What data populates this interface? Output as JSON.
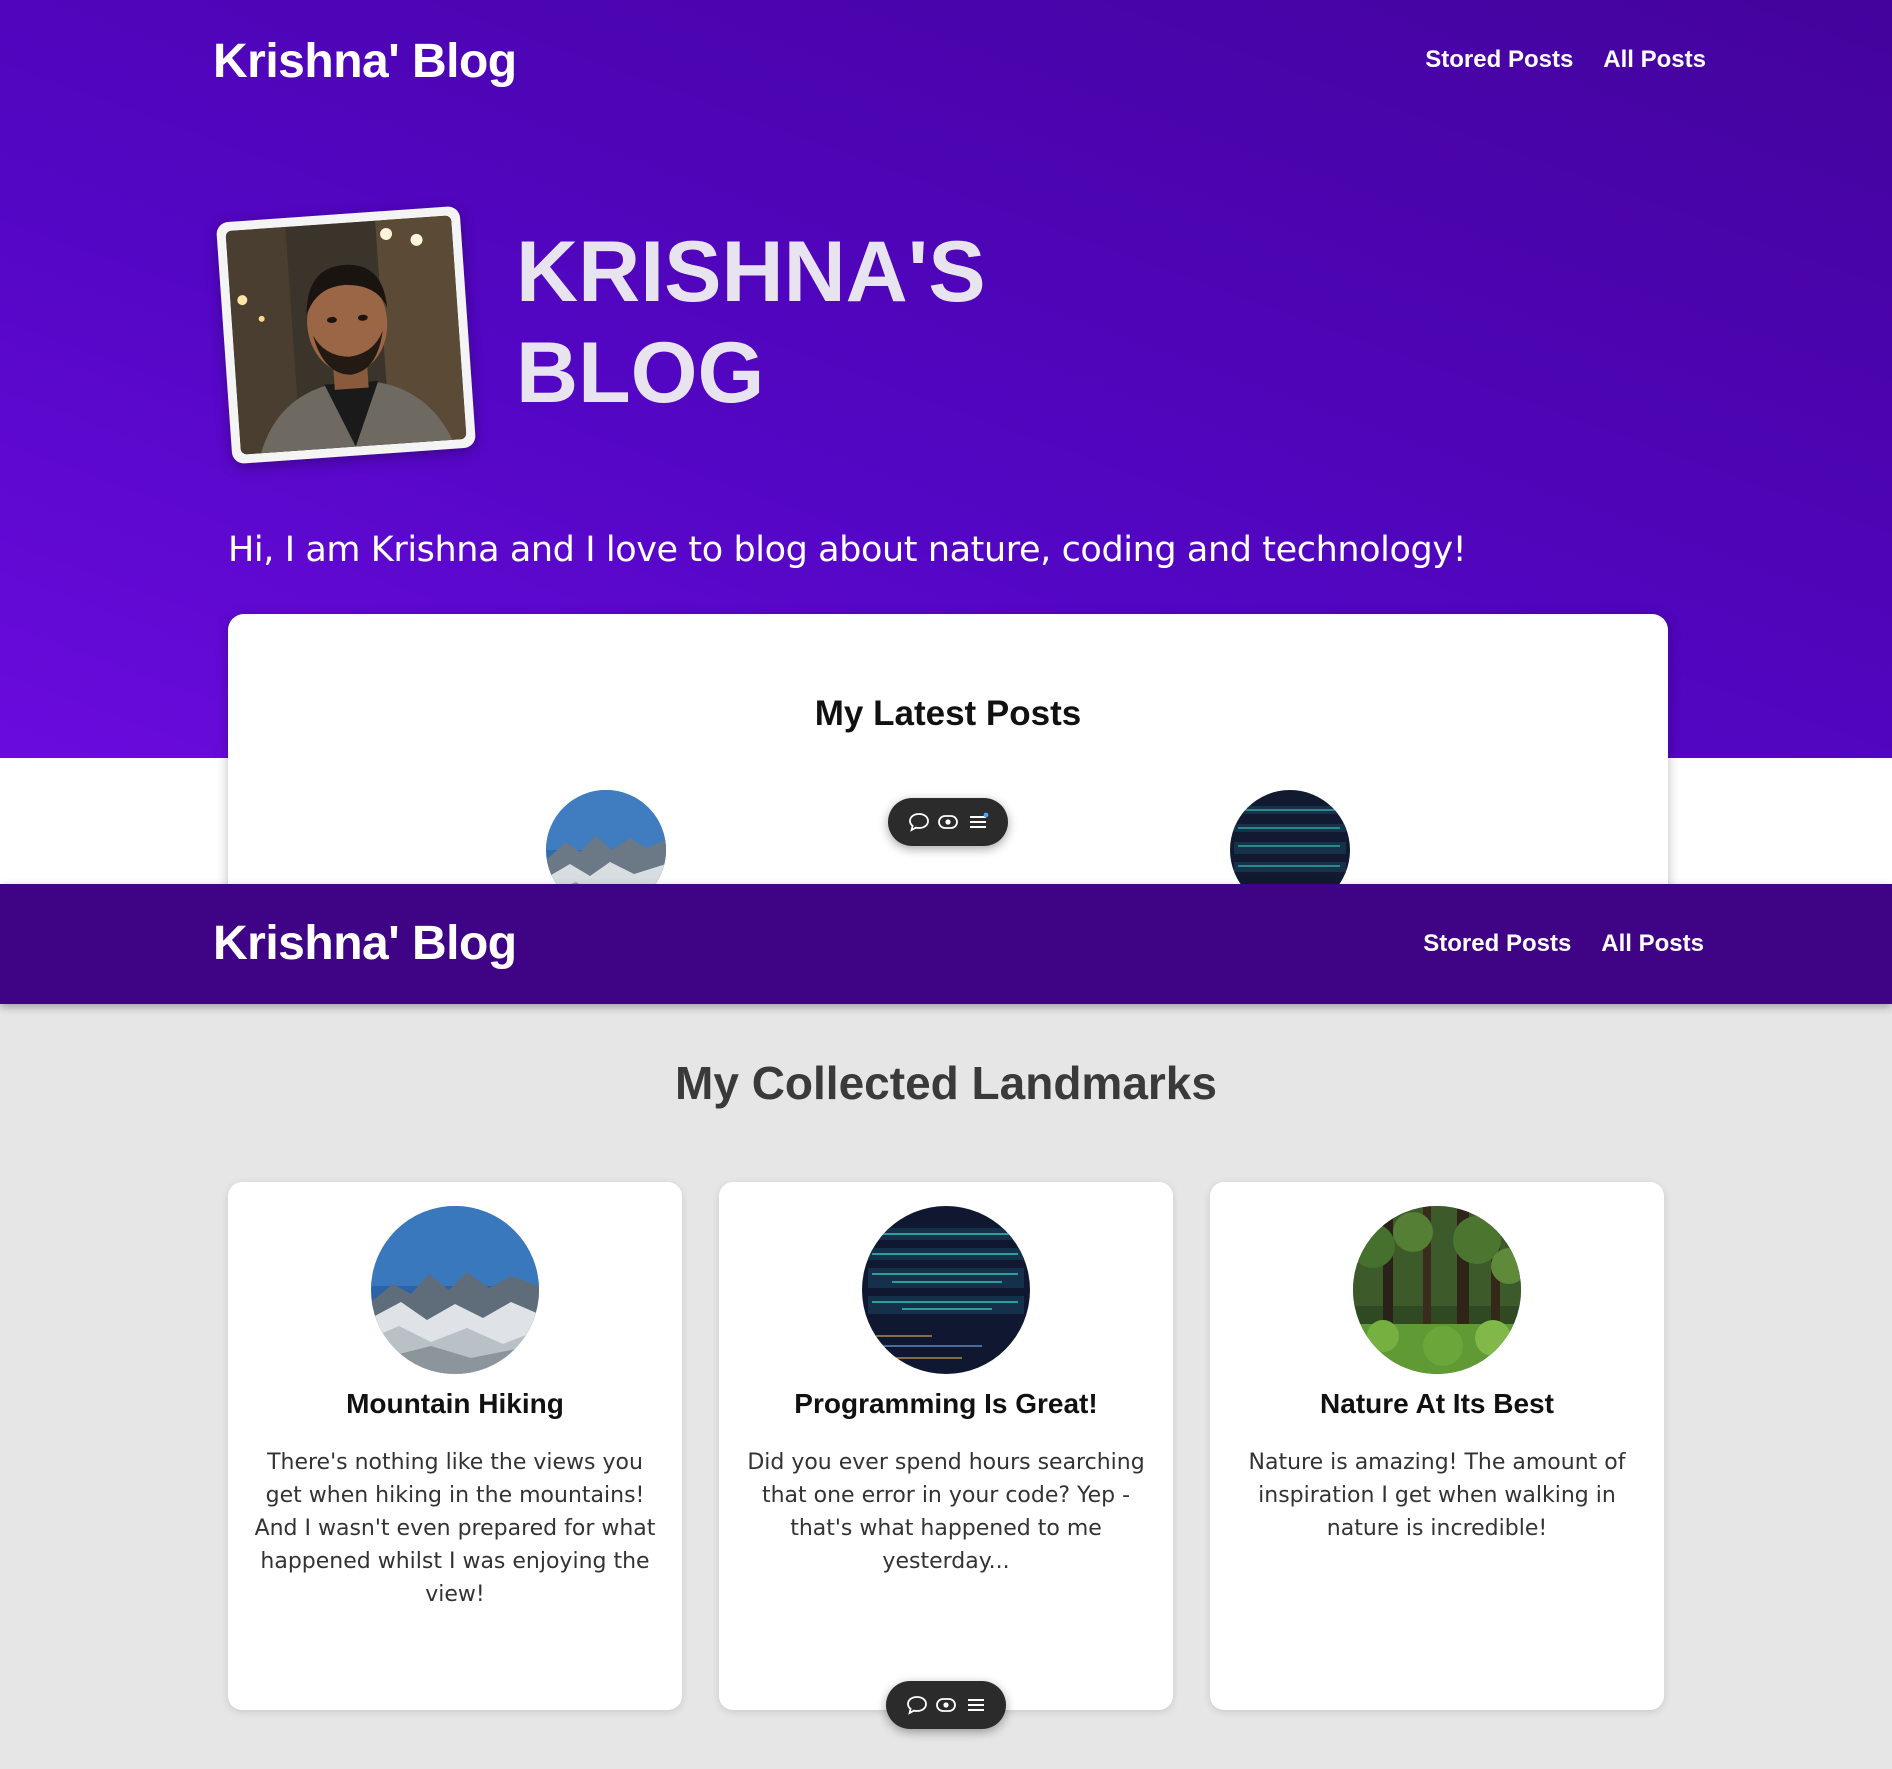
{
  "colors": {
    "hero_gradient_start": "#6a0bdd",
    "hero_gradient_end": "#44039c",
    "header_bar": "#3f0485",
    "page_background": "#e6e6e6",
    "toolbar": "#2b2b2b"
  },
  "home": {
    "nav": {
      "brand": "Krishna' Blog",
      "links": [
        "Stored Posts",
        "All Posts"
      ]
    },
    "hero": {
      "title_line1": "KRISHNA'S",
      "title_line2": "BLOG",
      "avatar": "profile-photo",
      "tagline": "Hi, I am Krishna and I love to blog about nature, coding and technology!"
    },
    "latest_posts": {
      "heading": "My Latest Posts"
    }
  },
  "stored": {
    "nav": {
      "brand": "Krishna' Blog",
      "links": [
        "Stored Posts",
        "All Posts"
      ]
    },
    "heading": "My Collected Landmarks",
    "posts": [
      {
        "title": "Mountain Hiking",
        "excerpt": "There's nothing like the views you get when hiking in the mountains! And I wasn't even prepared for what happened whilst I was enjoying the view!",
        "image": "mountains"
      },
      {
        "title": "Programming Is Great!",
        "excerpt": "Did you ever spend hours searching that one error in your code? Yep - that's what happened to me yesterday...",
        "image": "code-screen"
      },
      {
        "title": "Nature At Its Best",
        "excerpt": "Nature is amazing! The amount of inspiration I get when walking in nature is incredible!",
        "image": "forest"
      }
    ]
  },
  "toolbar_icons": [
    "comment-icon",
    "eye-icon",
    "menu-icon"
  ]
}
